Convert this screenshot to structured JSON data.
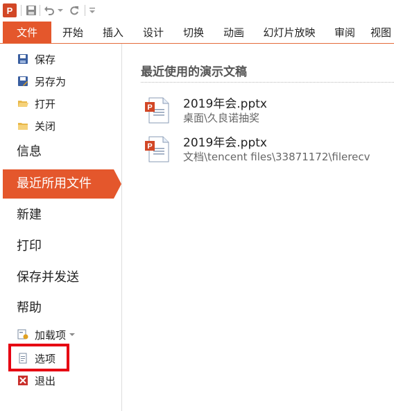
{
  "ribbon": {
    "tabs": [
      {
        "label": "文件"
      },
      {
        "label": "开始"
      },
      {
        "label": "插入"
      },
      {
        "label": "设计"
      },
      {
        "label": "切换"
      },
      {
        "label": "动画"
      },
      {
        "label": "幻灯片放映"
      },
      {
        "label": "审阅"
      },
      {
        "label": "视图"
      }
    ]
  },
  "nav": {
    "save": "保存",
    "save_as": "另存为",
    "open": "打开",
    "close": "关闭",
    "info": "信息",
    "recent": "最近所用文件",
    "new": "新建",
    "print": "打印",
    "save_send": "保存并发送",
    "help": "帮助",
    "addins": "加载项",
    "options": "选项",
    "exit": "退出"
  },
  "recent": {
    "title": "最近使用的演示文稿",
    "files": [
      {
        "name": "2019年会.pptx",
        "path": "桌面\\久良诺抽奖"
      },
      {
        "name": "2019年会.pptx",
        "path": "文档\\tencent files\\33871172\\filerecv"
      }
    ]
  },
  "colors": {
    "accent": "#e4572c",
    "highlight_box": "#e60012"
  },
  "icons": {
    "app": "powerpoint-logo-icon",
    "save": "floppy-disk-icon",
    "undo": "undo-icon",
    "redo": "redo-icon"
  }
}
